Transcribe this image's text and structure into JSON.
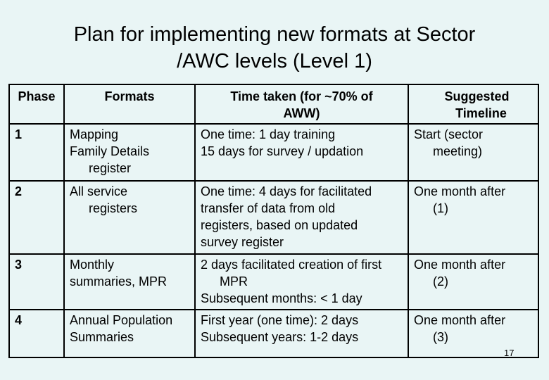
{
  "slide": {
    "title_line1": "Plan for implementing new formats at Sector",
    "title_line2": "/AWC levels (Level 1)",
    "page_number": "17"
  },
  "table": {
    "headers": {
      "phase": "Phase",
      "formats": "Formats",
      "time_line1": "Time taken (for ~70% of",
      "time_line2": "AWW)",
      "timeline_line1": "Suggested",
      "timeline_line2": "Timeline"
    },
    "rows": [
      {
        "phase": "1",
        "formats": [
          "Mapping",
          "Family Details",
          "register"
        ],
        "time": [
          "One time: 1 day training",
          "15 days for survey / updation"
        ],
        "timeline": [
          "Start (sector",
          "meeting)"
        ]
      },
      {
        "phase": "2",
        "formats": [
          "All service",
          "registers"
        ],
        "time": [
          "One time: 4 days for facilitated",
          "transfer of data from old",
          "registers, based on updated",
          "survey register"
        ],
        "timeline": [
          "One month after",
          "(1)"
        ]
      },
      {
        "phase": "3",
        "formats": [
          "Monthly",
          "summaries, MPR"
        ],
        "time": [
          "2 days facilitated creation of first",
          "MPR",
          "Subsequent months: < 1 day"
        ],
        "timeline": [
          "One month after",
          "(2)"
        ]
      },
      {
        "phase": "4",
        "formats": [
          "Annual Population",
          "Summaries"
        ],
        "time": [
          "First year (one time): 2 days",
          "Subsequent years: 1-2 days"
        ],
        "timeline": [
          "One month after",
          "(3)"
        ]
      }
    ]
  }
}
